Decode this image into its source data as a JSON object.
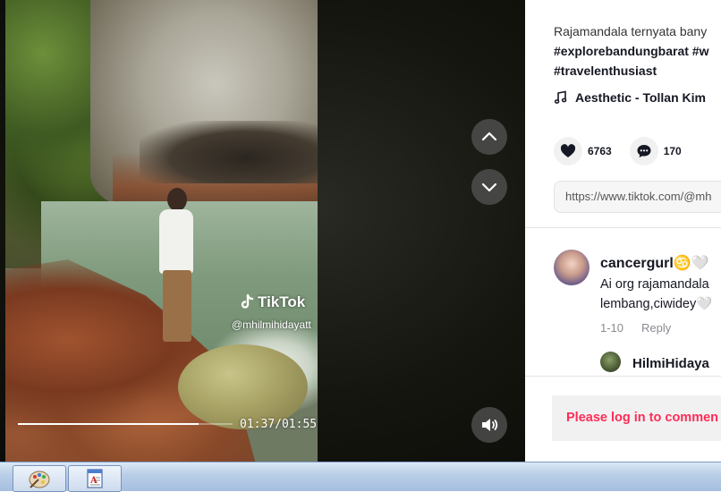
{
  "video": {
    "watermark_brand": "TikTok",
    "watermark_user": "@mhilmihidayatt",
    "progress_time": "01:37/01:55",
    "progress_fraction": 0.84
  },
  "post": {
    "caption_line1": "Rajamandala ternyata bany",
    "caption_tags_line2": "#explorebandungbarat #w",
    "caption_tags_line3": "#travelenthusiast",
    "music": "Aesthetic - Tollan Kim",
    "likes": "6763",
    "comments": "170",
    "url": "https://www.tiktok.com/@mh"
  },
  "comment": {
    "user": "cancergurl♋🤍",
    "text_line1": "Ai org rajamandala",
    "text_line2": "lembang,ciwidey🤍",
    "date": "1-10",
    "reply_label": "Reply",
    "reply_user": "HilmiHidaya"
  },
  "login_prompt": "Please log in to commen",
  "icons": {
    "nav_up": "chevron-up-icon",
    "nav_down": "chevron-down-icon",
    "volume": "volume-icon",
    "music": "music-note-icon",
    "like": "heart-icon",
    "comment": "comment-icon"
  },
  "colors": {
    "accent": "#fe2c55",
    "text": "#161823",
    "muted": "#8a8b91"
  }
}
